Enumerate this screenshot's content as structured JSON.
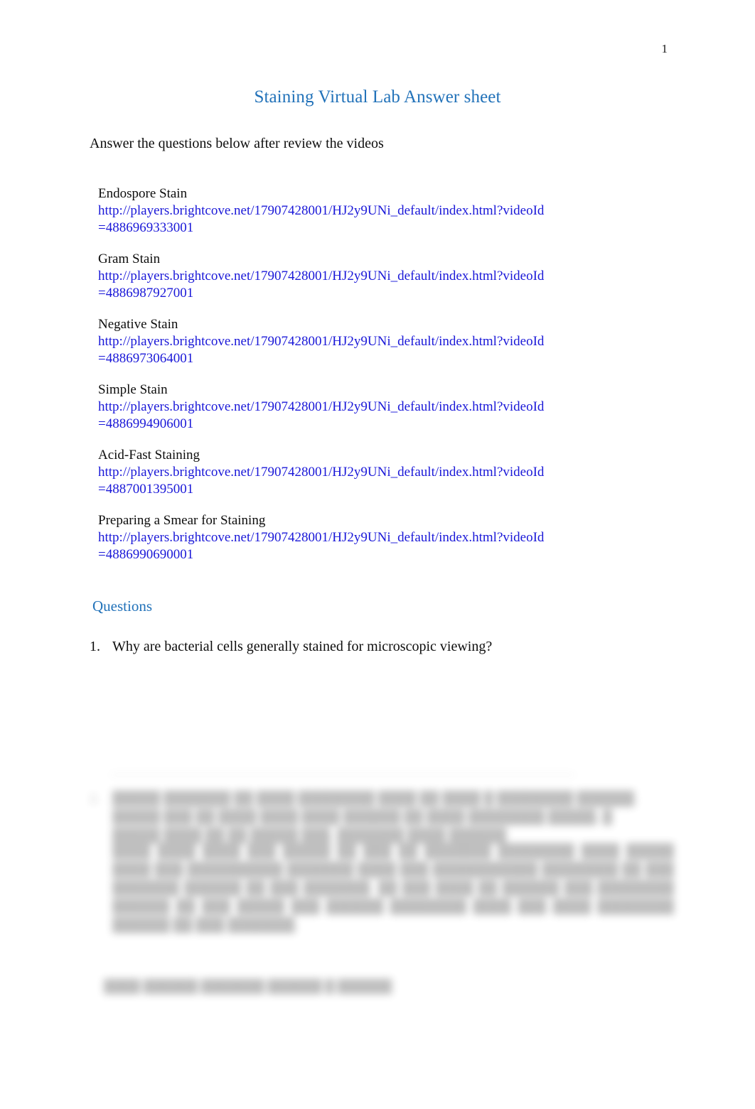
{
  "document": {
    "page_number": "1",
    "title": "Staining Virtual Lab Answer sheet",
    "intro": "Answer the questions below after review the videos"
  },
  "videos": [
    {
      "label": "Endospore Stain",
      "url": "http://players.brightcove.net/17907428001/HJ2y9UNi_default/index.html?videoId=4886969333001"
    },
    {
      "label": "Gram Stain",
      "url": "http://players.brightcove.net/17907428001/HJ2y9UNi_default/index.html?videoId=4886987927001"
    },
    {
      "label": "Negative Stain",
      "url": "http://players.brightcove.net/17907428001/HJ2y9UNi_default/index.html?videoId=4886973064001"
    },
    {
      "label": "Simple Stain",
      "url": "http://players.brightcove.net/17907428001/HJ2y9UNi_default/index.html?videoId=4886994906001"
    },
    {
      "label": "Acid-Fast Staining",
      "url": "http://players.brightcove.net/17907428001/HJ2y9UNi_default/index.html?videoId=4887001395001"
    },
    {
      "label": "Preparing a Smear for Staining",
      "url": "http://players.brightcove.net/17907428001/HJ2y9UNi_default/index.html?videoId=4886990690001"
    }
  ],
  "questions_section": {
    "heading": "Questions",
    "items": [
      {
        "marker": "1.",
        "text": "Why are bacterial cells generally stained for microscopic viewing?"
      }
    ]
  },
  "redacted": {
    "note": "lower portion of page is blurred and illegible",
    "question_marker": "2.",
    "question_text": "█████ ███████ ██ ████ ████████ ████ ██ ████ █ ████████ ██████. █████ ███ ██ ████ ████ ████ ██████ ██ ████ ████████ █████, █ █████ ████ ██ ██ █████ ███. ███████ ████ ██████",
    "answer_text": "████ ████ ████ ███ █████ ██ ███ ██ ███████ ████████ ████ █████ ████ ███ ██████████ ███████ ████ ███ ███████████ ████████ ██ ███ ███████ ██████ ██ ███ ███████. ██ ███ ████ ██ ██████ ███ ████████ ██████ ██ ███ █████ ███ ██████ ████████ ████ ███ ████ ████████ ██████ ██ ███ ███████.",
    "footer_text": "████ ██████ ███████ ██████ █ ██████"
  },
  "colors": {
    "heading_blue": "#2272b9",
    "link_blue": "#1a18d8",
    "body_text": "#0d0d0d",
    "page_background": "#ffffff"
  }
}
